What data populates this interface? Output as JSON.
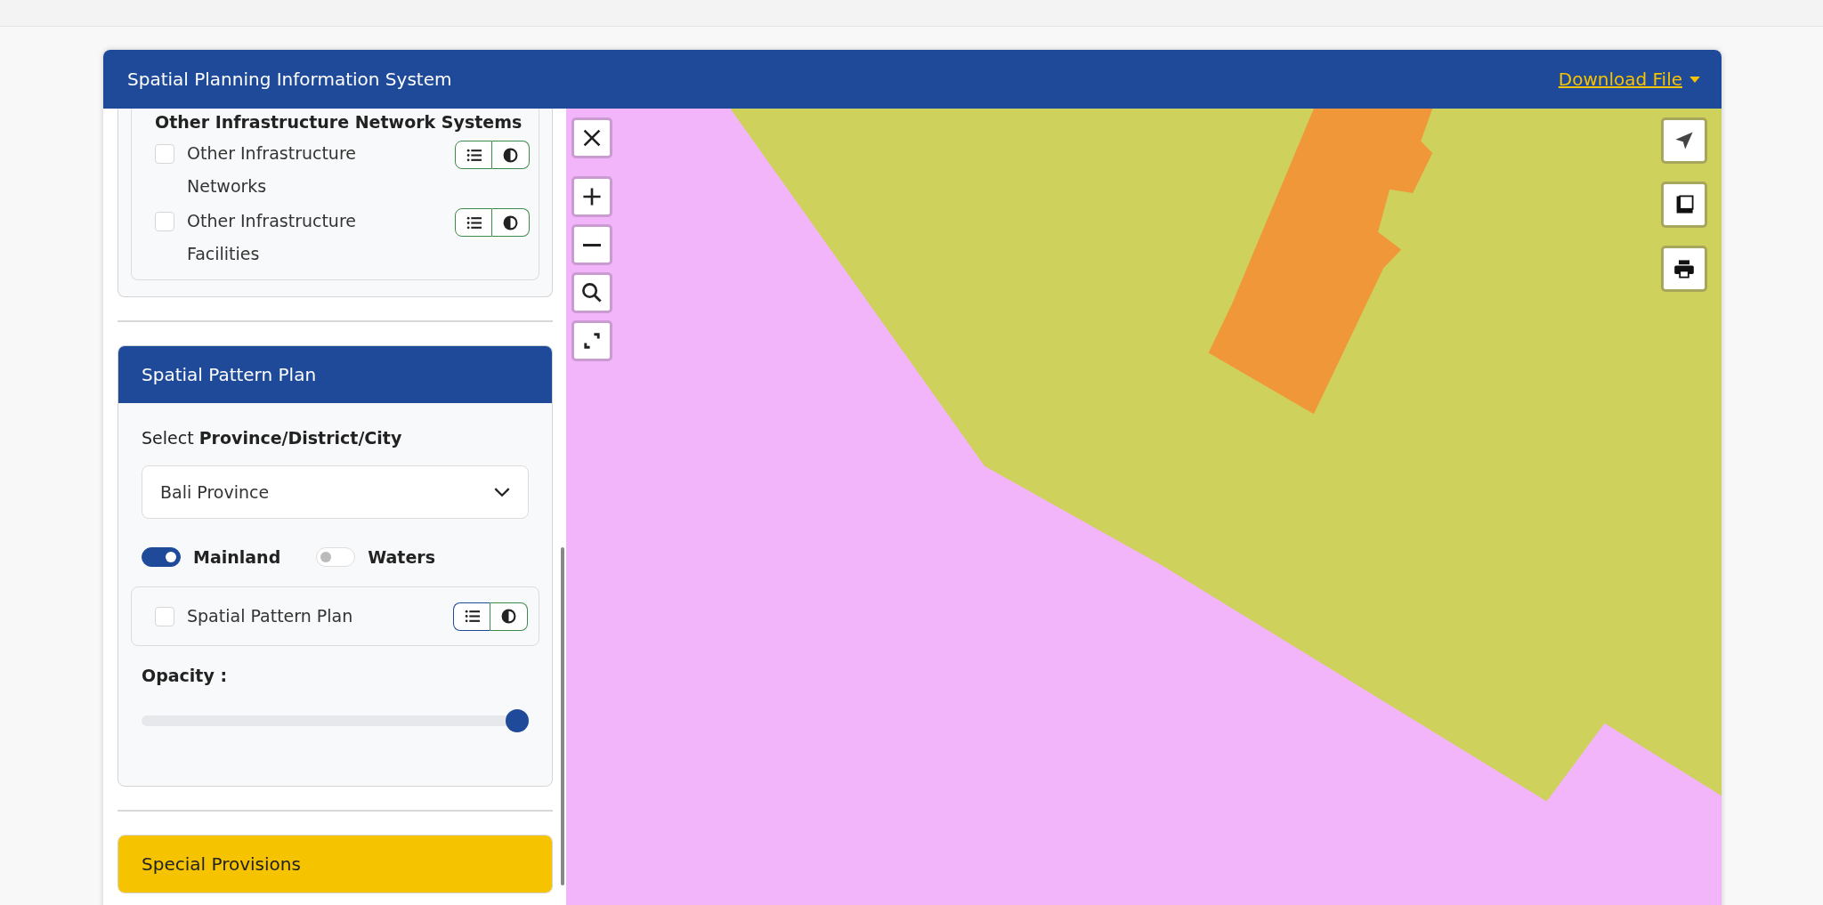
{
  "header": {
    "title": "Spatial Planning Information System",
    "download_link": "Download File"
  },
  "infrastructure_card": {
    "heading": "Other Infrastructure Network Systems",
    "layers": [
      {
        "label": "Other Infrastructure Networks",
        "checked": false,
        "legend_selected": false
      },
      {
        "label": "Other Infrastructure Facilities",
        "checked": false,
        "legend_selected": false
      }
    ]
  },
  "spatial_pattern_card": {
    "title": "Spatial Pattern Plan",
    "select_label": "Select **Province/District/City**",
    "select_value": "Bali Province",
    "toggles": [
      {
        "label": "Mainland",
        "on": true
      },
      {
        "label": "Waters",
        "on": false
      }
    ],
    "layers": [
      {
        "label": "Spatial Pattern Plan",
        "checked": false,
        "legend_selected": true
      }
    ],
    "opacity_label": "Opacity :",
    "opacity": {
      "level": 1
    }
  },
  "special_card": {
    "title": "Special Provisions"
  }
}
